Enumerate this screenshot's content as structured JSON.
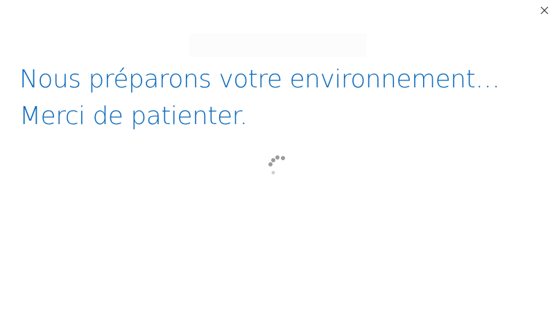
{
  "dialog": {
    "close_icon": "close-icon",
    "heading_line1": "Nous préparons votre environnement…",
    "heading_line2": "Merci de patienter.",
    "loading_icon": "loading-spinner-icon"
  },
  "colors": {
    "heading": "#0f6cbd",
    "spinner_dot": "#9a9a9a",
    "close_glyph": "#333333",
    "background": "#ffffff"
  }
}
